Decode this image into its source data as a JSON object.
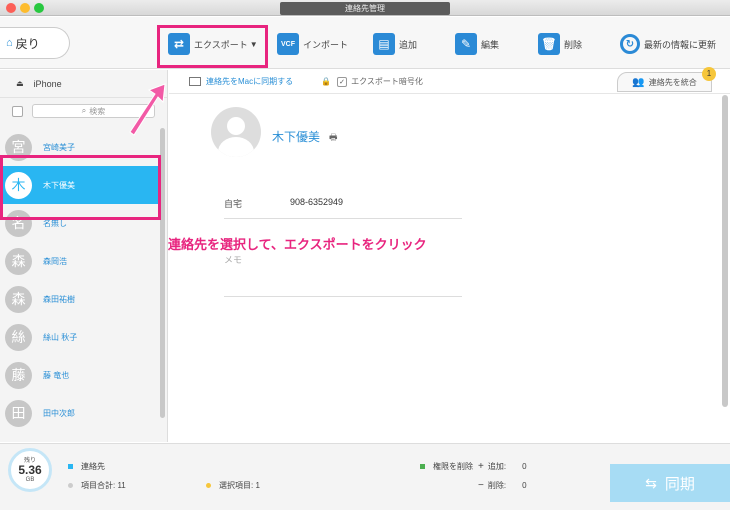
{
  "window": {
    "title": "連絡先管理"
  },
  "toolbar": {
    "back_label": "戻り",
    "export_label": "エクスポート",
    "import_label": "インポート",
    "add_label": "追加",
    "edit_label": "編集",
    "delete_label": "削除",
    "refresh_label": "最新の情報に更新"
  },
  "sidebar": {
    "device": "iPhone",
    "search_placeholder": "検索",
    "contacts": [
      {
        "initial": "宮",
        "name": "宮崎美子",
        "selected": false
      },
      {
        "initial": "木",
        "name": "木下優美",
        "selected": true
      },
      {
        "initial": "名",
        "name": "名無し",
        "selected": false
      },
      {
        "initial": "森",
        "name": "森岡浩",
        "selected": false
      },
      {
        "initial": "森",
        "name": "森田祐樹",
        "selected": false
      },
      {
        "initial": "絲",
        "name": "絲山 秋子",
        "selected": false
      },
      {
        "initial": "藤",
        "name": "藤 竜也",
        "selected": false
      },
      {
        "initial": "田",
        "name": "田中次郎",
        "selected": false
      }
    ]
  },
  "subbar": {
    "sync_to_mac": "連絡先をMacに同期する",
    "export_encrypt": "エクスポート暗号化",
    "merge_label": "連絡先を統合",
    "merge_badge": "1"
  },
  "detail": {
    "name": "木下優美",
    "phone_label": "自宅",
    "phone_value": "908-6352949",
    "memo_label": "メモ"
  },
  "annotation": "連絡先を選択して、エクスポートをクリック",
  "footer": {
    "storage_label": "残り",
    "storage_value": "5.36",
    "storage_unit": "GB",
    "contacts_label": "連絡先",
    "total_items": "項目合計: 11",
    "selected_items": "選択項目: 1",
    "perm_delete": "権限を削除",
    "add_label": "追加:",
    "add_count": "0",
    "delete_label": "削除:",
    "delete_count": "0",
    "sync_label": "同期"
  },
  "colors": {
    "accent": "#29b6f2",
    "highlight": "#e8257f",
    "link": "#2a8fd6"
  }
}
